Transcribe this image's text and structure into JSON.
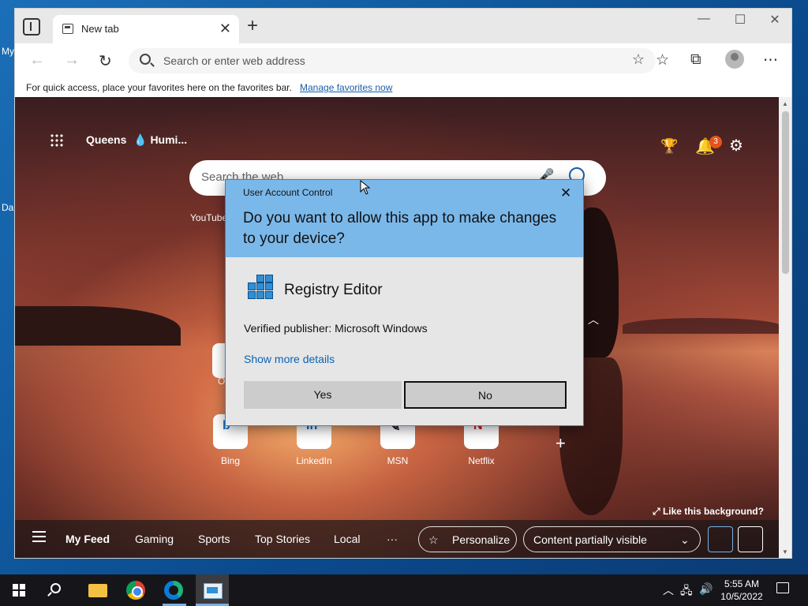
{
  "desktop": {
    "fragments": [
      {
        "text": "My"
      },
      {
        "text": "Da"
      }
    ]
  },
  "browser": {
    "tab": {
      "title": "New tab"
    },
    "new_tab_symbol": "+",
    "window_controls": {
      "minimize": "—",
      "maximize": "☐",
      "close": "✕"
    },
    "toolbar": {
      "back": "←",
      "forward": "→",
      "refresh": "↻",
      "address_placeholder": "Search or enter web address"
    },
    "favorites_bar": {
      "message": "For quick access, place your favorites here on the favorites bar.",
      "link": "Manage favorites now"
    }
  },
  "newtab": {
    "location": "Queens",
    "weather": "Humi...",
    "notification_count": "3",
    "search_placeholder": "Search the web",
    "top_sites": [
      {
        "label": "Bing",
        "icon": "b",
        "color": "#1a73c8"
      },
      {
        "label": "LinkedIn",
        "icon": "in",
        "color": "#0a66c2"
      },
      {
        "label": "MSN",
        "icon": "✎",
        "color": "#111111"
      },
      {
        "label": "Netflix",
        "icon": "N",
        "color": "#e50914"
      }
    ],
    "partial_labels": {
      "youtube": "YouTube",
      "partial_tile": "O"
    },
    "like_background": "Like this background?",
    "feed_tabs": [
      "My Feed",
      "Gaming",
      "Sports",
      "Top Stories",
      "Local"
    ],
    "feed_more": "···",
    "personalize": "Personalize",
    "content_visibility": "Content partially visible"
  },
  "uac": {
    "title": "User Account Control",
    "question": "Do you want to allow this app to make changes to your device?",
    "app_name": "Registry Editor",
    "publisher": "Verified publisher: Microsoft Windows",
    "details_link": "Show more details",
    "yes": "Yes",
    "no": "No",
    "header_color": "#7bb8ea"
  },
  "taskbar": {
    "time": "5:55 AM",
    "date": "10/5/2022"
  }
}
